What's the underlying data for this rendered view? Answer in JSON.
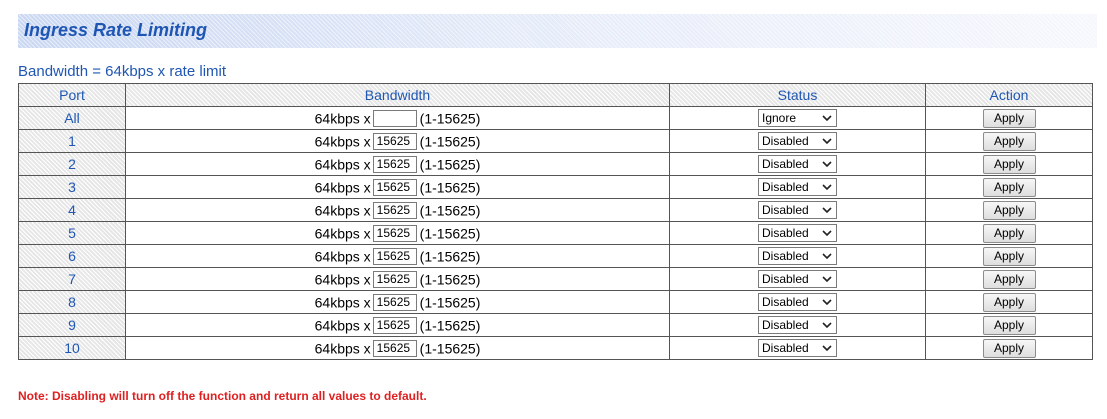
{
  "page": {
    "title": "Ingress Rate Limiting",
    "subtitle": "Bandwidth = 64kbps x rate limit",
    "note": "Note: Disabling will turn off the function and return all values to default."
  },
  "table": {
    "headers": [
      "Port",
      "Bandwidth",
      "Status",
      "Action"
    ],
    "bandwidth_prefix": "64kbps x",
    "range_label": "(1-15625)",
    "apply_label": "Apply",
    "rows": [
      {
        "port": "All",
        "value": "",
        "status": "Ignore"
      },
      {
        "port": "1",
        "value": "15625",
        "status": "Disabled"
      },
      {
        "port": "2",
        "value": "15625",
        "status": "Disabled"
      },
      {
        "port": "3",
        "value": "15625",
        "status": "Disabled"
      },
      {
        "port": "4",
        "value": "15625",
        "status": "Disabled"
      },
      {
        "port": "5",
        "value": "15625",
        "status": "Disabled"
      },
      {
        "port": "6",
        "value": "15625",
        "status": "Disabled"
      },
      {
        "port": "7",
        "value": "15625",
        "status": "Disabled"
      },
      {
        "port": "8",
        "value": "15625",
        "status": "Disabled"
      },
      {
        "port": "9",
        "value": "15625",
        "status": "Disabled"
      },
      {
        "port": "10",
        "value": "15625",
        "status": "Disabled"
      }
    ]
  },
  "colors": {
    "title_text": "#1f56b3",
    "note_text": "#e02020"
  }
}
